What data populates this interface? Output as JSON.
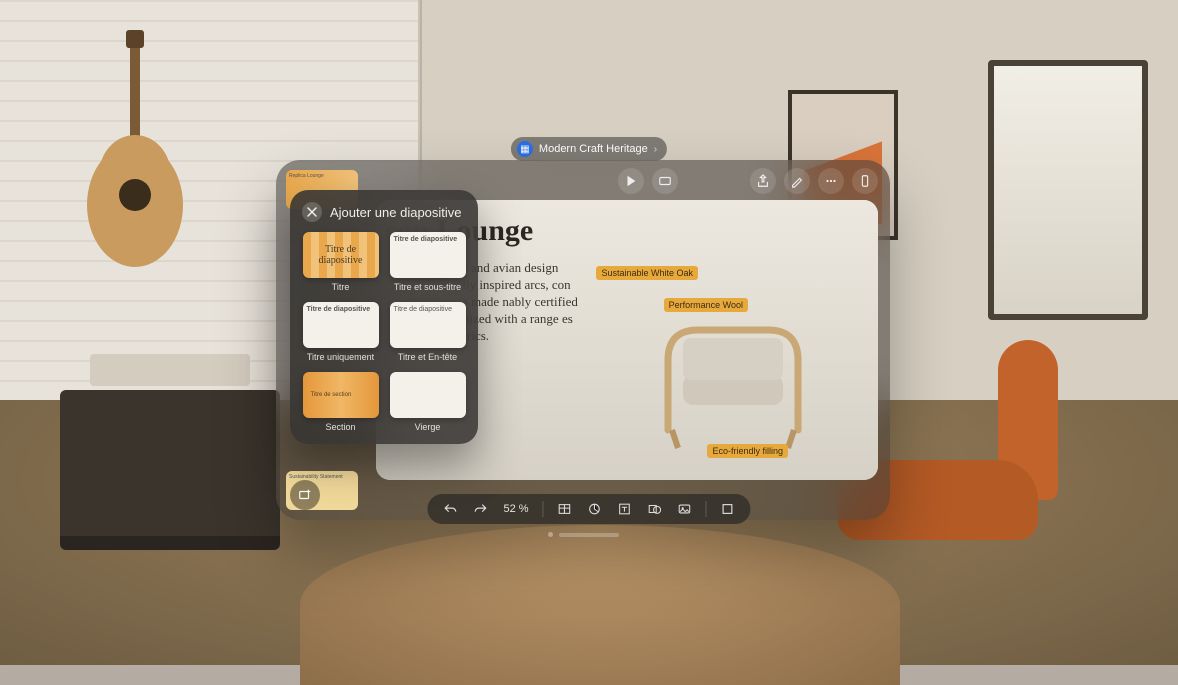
{
  "document": {
    "title": "Modern Craft Heritage"
  },
  "slide": {
    "title": "con Lounge",
    "body": "from a Japanese and avian design sensibility nically inspired arcs, con Lounge Chair is made nably certified Canadian armonized with a range es and colorful fabrics.",
    "callouts": {
      "oak": "Sustainable White Oak",
      "wool": "Performance Wool",
      "fill": "Eco-friendly filling"
    }
  },
  "popover": {
    "title": "Ajouter une diapositive",
    "items": [
      {
        "thumb_text": "Titre de diapositive",
        "label": "Titre"
      },
      {
        "thumb_text": "Titre de diapositive",
        "label": "Titre et sous-titre"
      },
      {
        "thumb_text": "Titre de diapositive",
        "label": "Titre uniquement"
      },
      {
        "thumb_text": "Titre de diapositive",
        "label": "Titre et En-tête"
      },
      {
        "thumb_text": "Titre de section",
        "label": "Section"
      },
      {
        "thumb_text": "",
        "label": "Vierge"
      }
    ]
  },
  "bottom": {
    "zoom": "52 %"
  },
  "thumbs": {
    "t1": "Replica Lounge",
    "t2": "Sustainability Statement"
  }
}
